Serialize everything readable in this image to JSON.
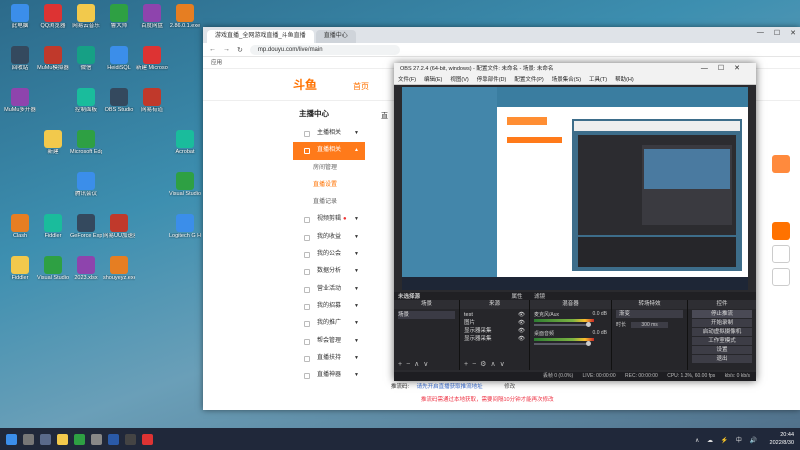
{
  "desktop": {
    "icons": [
      "此电脑",
      "QQ浏览器",
      "网易云音乐",
      "鲁大师",
      "百度网盘",
      "2.86.0.1.exe",
      "新建文本文档",
      "回收站",
      "MuMu模拟器",
      "微信",
      "HeidiSQL",
      "新建 Microsoft",
      "",
      "网络",
      "MuMu多开器",
      "",
      "控制面板",
      "OBS Studio",
      "网易有道",
      "",
      "Steam",
      "",
      "新建",
      "Microsoft Edge",
      "",
      "",
      "Acrobat",
      "Epic Games",
      "",
      "",
      "腾讯会议",
      "",
      "",
      "Visual Studio Code",
      "",
      "Clash",
      "Fiddler",
      "GeForce Experience",
      "网易UU加速器",
      "",
      "Logitech G HUB",
      "网易UU加速器",
      "Fiddler",
      "Visual Studio Code",
      "2023.xlsx",
      "shouyeyz.exe"
    ]
  },
  "browser": {
    "tabs": [
      "游戏直播_全网游戏直播_斗鱼直播",
      "直播中心"
    ],
    "url": "mp.douyu.com/live/main",
    "bookmarks": "应用",
    "site": {
      "logo": "斗鱼",
      "nav": [
        "首页",
        "直播"
      ]
    },
    "sidebar": {
      "title": "主播中心",
      "items": [
        {
          "label": "主播相关",
          "type": "main"
        },
        {
          "label": "直播相关",
          "type": "active"
        },
        {
          "label": "房间管理",
          "type": "sub"
        },
        {
          "label": "直播设置",
          "type": "sub-hl"
        },
        {
          "label": "直播记录",
          "type": "sub"
        },
        {
          "label": "视频剪辑",
          "type": "main",
          "dot": "●"
        },
        {
          "label": "我的收益",
          "type": "main"
        },
        {
          "label": "我的公会",
          "type": "main"
        },
        {
          "label": "数据分析",
          "type": "main"
        },
        {
          "label": "营业活动",
          "type": "main"
        },
        {
          "label": "我的招募",
          "type": "main"
        },
        {
          "label": "我的推广",
          "type": "main"
        },
        {
          "label": "帮会管理",
          "type": "main"
        },
        {
          "label": "直播扶持",
          "type": "main"
        },
        {
          "label": "直播神器",
          "type": "main"
        }
      ]
    },
    "main": {
      "heading": "直",
      "rtmp_label": "推流码:",
      "rtmp_link": "请先开启直播获取推流地址",
      "modify": "修改",
      "tip": "推流码需通过本地获取，需要间隔10分钟才能再次修改"
    }
  },
  "obs": {
    "title": "OBS 27.2.4 (64-bit, windows) - 配置文件: 未命名 - 场景: 未命名",
    "menu": [
      "文件(F)",
      "编辑(E)",
      "视图(V)",
      "停靠部件(D)",
      "配置文件(P)",
      "场景集合(S)",
      "工具(T)",
      "帮助(H)"
    ],
    "preview_label": "未选择源",
    "preview_props": "属性",
    "preview_filters": "滤镜",
    "docks": {
      "scenes": {
        "title": "场景",
        "items": [
          "场景"
        ]
      },
      "sources": {
        "title": "来源",
        "items": [
          "test",
          "图片",
          "显示器采集",
          "显示器采集"
        ]
      },
      "mixer": {
        "title": "混音器",
        "channels": [
          {
            "name": "麦克风/Aux",
            "level": "0.0 dB"
          },
          {
            "name": "桌面音频",
            "level": "0.0 dB"
          }
        ]
      },
      "transitions": {
        "title": "转场特效",
        "mode": "渐变",
        "duration_label": "时长",
        "duration": "300 ms"
      },
      "controls": {
        "title": "控件",
        "buttons": [
          "停止推流",
          "开始录制",
          "启动虚拟摄像机",
          "工作室模式",
          "设置",
          "退出"
        ]
      }
    },
    "status": {
      "dropped": "丢帧 0 (0.0%)",
      "live": "LIVE: 00:00:00",
      "rec": "REC: 00:00:00",
      "cpu": "CPU: 1.3%, 60.00 fps",
      "kbps": "kb/s: 0 kb/s"
    }
  },
  "taskbar": {
    "time": "20:44",
    "date": "2022/8/30"
  },
  "colors": {
    "accent": "#ff7200",
    "obs_bg": "#2a2a2e",
    "taskbar": "#20283a"
  }
}
